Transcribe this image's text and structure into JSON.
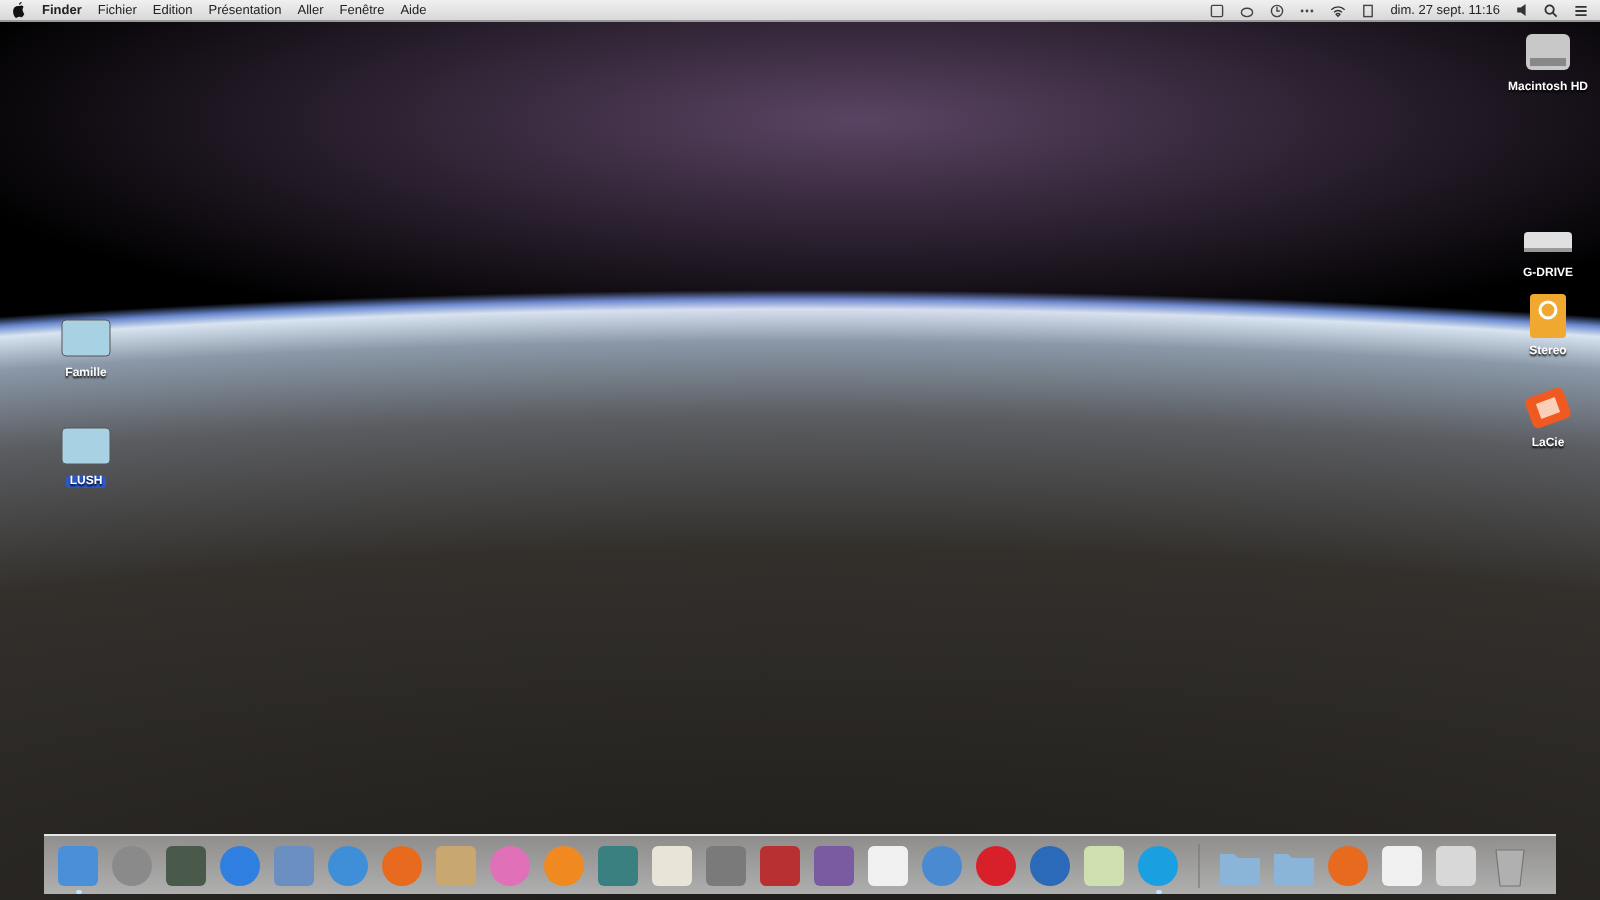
{
  "menu_bar": {
    "menus": [
      {
        "label": "Finder",
        "kind": "app"
      },
      {
        "label": "Fichier",
        "kind": "menu"
      },
      {
        "label": "Edition",
        "kind": "menu"
      },
      {
        "label": "Présentation",
        "kind": "menu"
      },
      {
        "label": "Aller",
        "kind": "menu"
      },
      {
        "label": "Fenêtre",
        "kind": "menu"
      },
      {
        "label": "Aide",
        "kind": "menu"
      }
    ],
    "date_time": "dim. 27 sept.  11:16"
  },
  "left_icons": [
    {
      "label": "Famille",
      "kind": "folder",
      "selected": false
    },
    {
      "label": "LUSH",
      "kind": "folder",
      "selected": true
    }
  ],
  "right_icons": [
    {
      "label": "Macintosh HD",
      "kind": "disk",
      "selected": false
    },
    {
      "label": "G-DRIVE",
      "kind": "drive",
      "selected": false
    },
    {
      "label": "Stereo",
      "kind": "firewire",
      "selected": false
    },
    {
      "label": "LaCie",
      "kind": "lacie",
      "selected": false
    }
  ],
  "dock": {
    "apps": [
      {
        "kind": "square",
        "color": "#4a90d9",
        "running": true
      },
      {
        "kind": "circle",
        "color": "#8a8a8a",
        "running": false
      },
      {
        "kind": "square",
        "color": "#4a5a4a",
        "running": false
      },
      {
        "kind": "circle",
        "color": "#2f7fe0",
        "running": false
      },
      {
        "kind": "square",
        "color": "#6a8fc0",
        "running": false
      },
      {
        "kind": "circle",
        "color": "#3f8fd8",
        "running": false
      },
      {
        "kind": "circle",
        "color": "#e86a1f",
        "running": false
      },
      {
        "kind": "square",
        "color": "#c8a870",
        "running": false
      },
      {
        "kind": "circle",
        "color": "#e070b8",
        "running": false
      },
      {
        "kind": "circle",
        "color": "#f08a20",
        "running": false
      },
      {
        "kind": "square",
        "color": "#3a8080",
        "running": false
      },
      {
        "kind": "square",
        "color": "#e8e4d8",
        "running": false
      },
      {
        "kind": "square",
        "color": "#7a7a7a",
        "running": false
      },
      {
        "kind": "square",
        "color": "#b83030",
        "running": false
      },
      {
        "kind": "square",
        "color": "#7a5aa0",
        "running": false
      },
      {
        "kind": "square",
        "color": "#f0f0f0",
        "running": false
      },
      {
        "kind": "circle",
        "color": "#4a8ad0",
        "running": false
      },
      {
        "kind": "circle",
        "color": "#d8202a",
        "running": false
      },
      {
        "kind": "circle",
        "color": "#2a6ab8",
        "running": false
      },
      {
        "kind": "square",
        "color": "#cfe0b0",
        "running": false
      },
      {
        "kind": "circle",
        "color": "#1aa0e0",
        "running": true
      }
    ],
    "others": [
      {
        "kind": "folder",
        "color": "#8ab4d8",
        "running": false
      },
      {
        "kind": "folder",
        "color": "#8ab4d8",
        "running": false
      },
      {
        "kind": "circle",
        "color": "#e86a1f",
        "running": false
      },
      {
        "kind": "square",
        "color": "#f0f0f0",
        "running": false
      },
      {
        "kind": "square",
        "color": "#d8d8d8",
        "running": false
      },
      {
        "kind": "trash",
        "color": "#b0b0b0",
        "running": false
      }
    ]
  }
}
